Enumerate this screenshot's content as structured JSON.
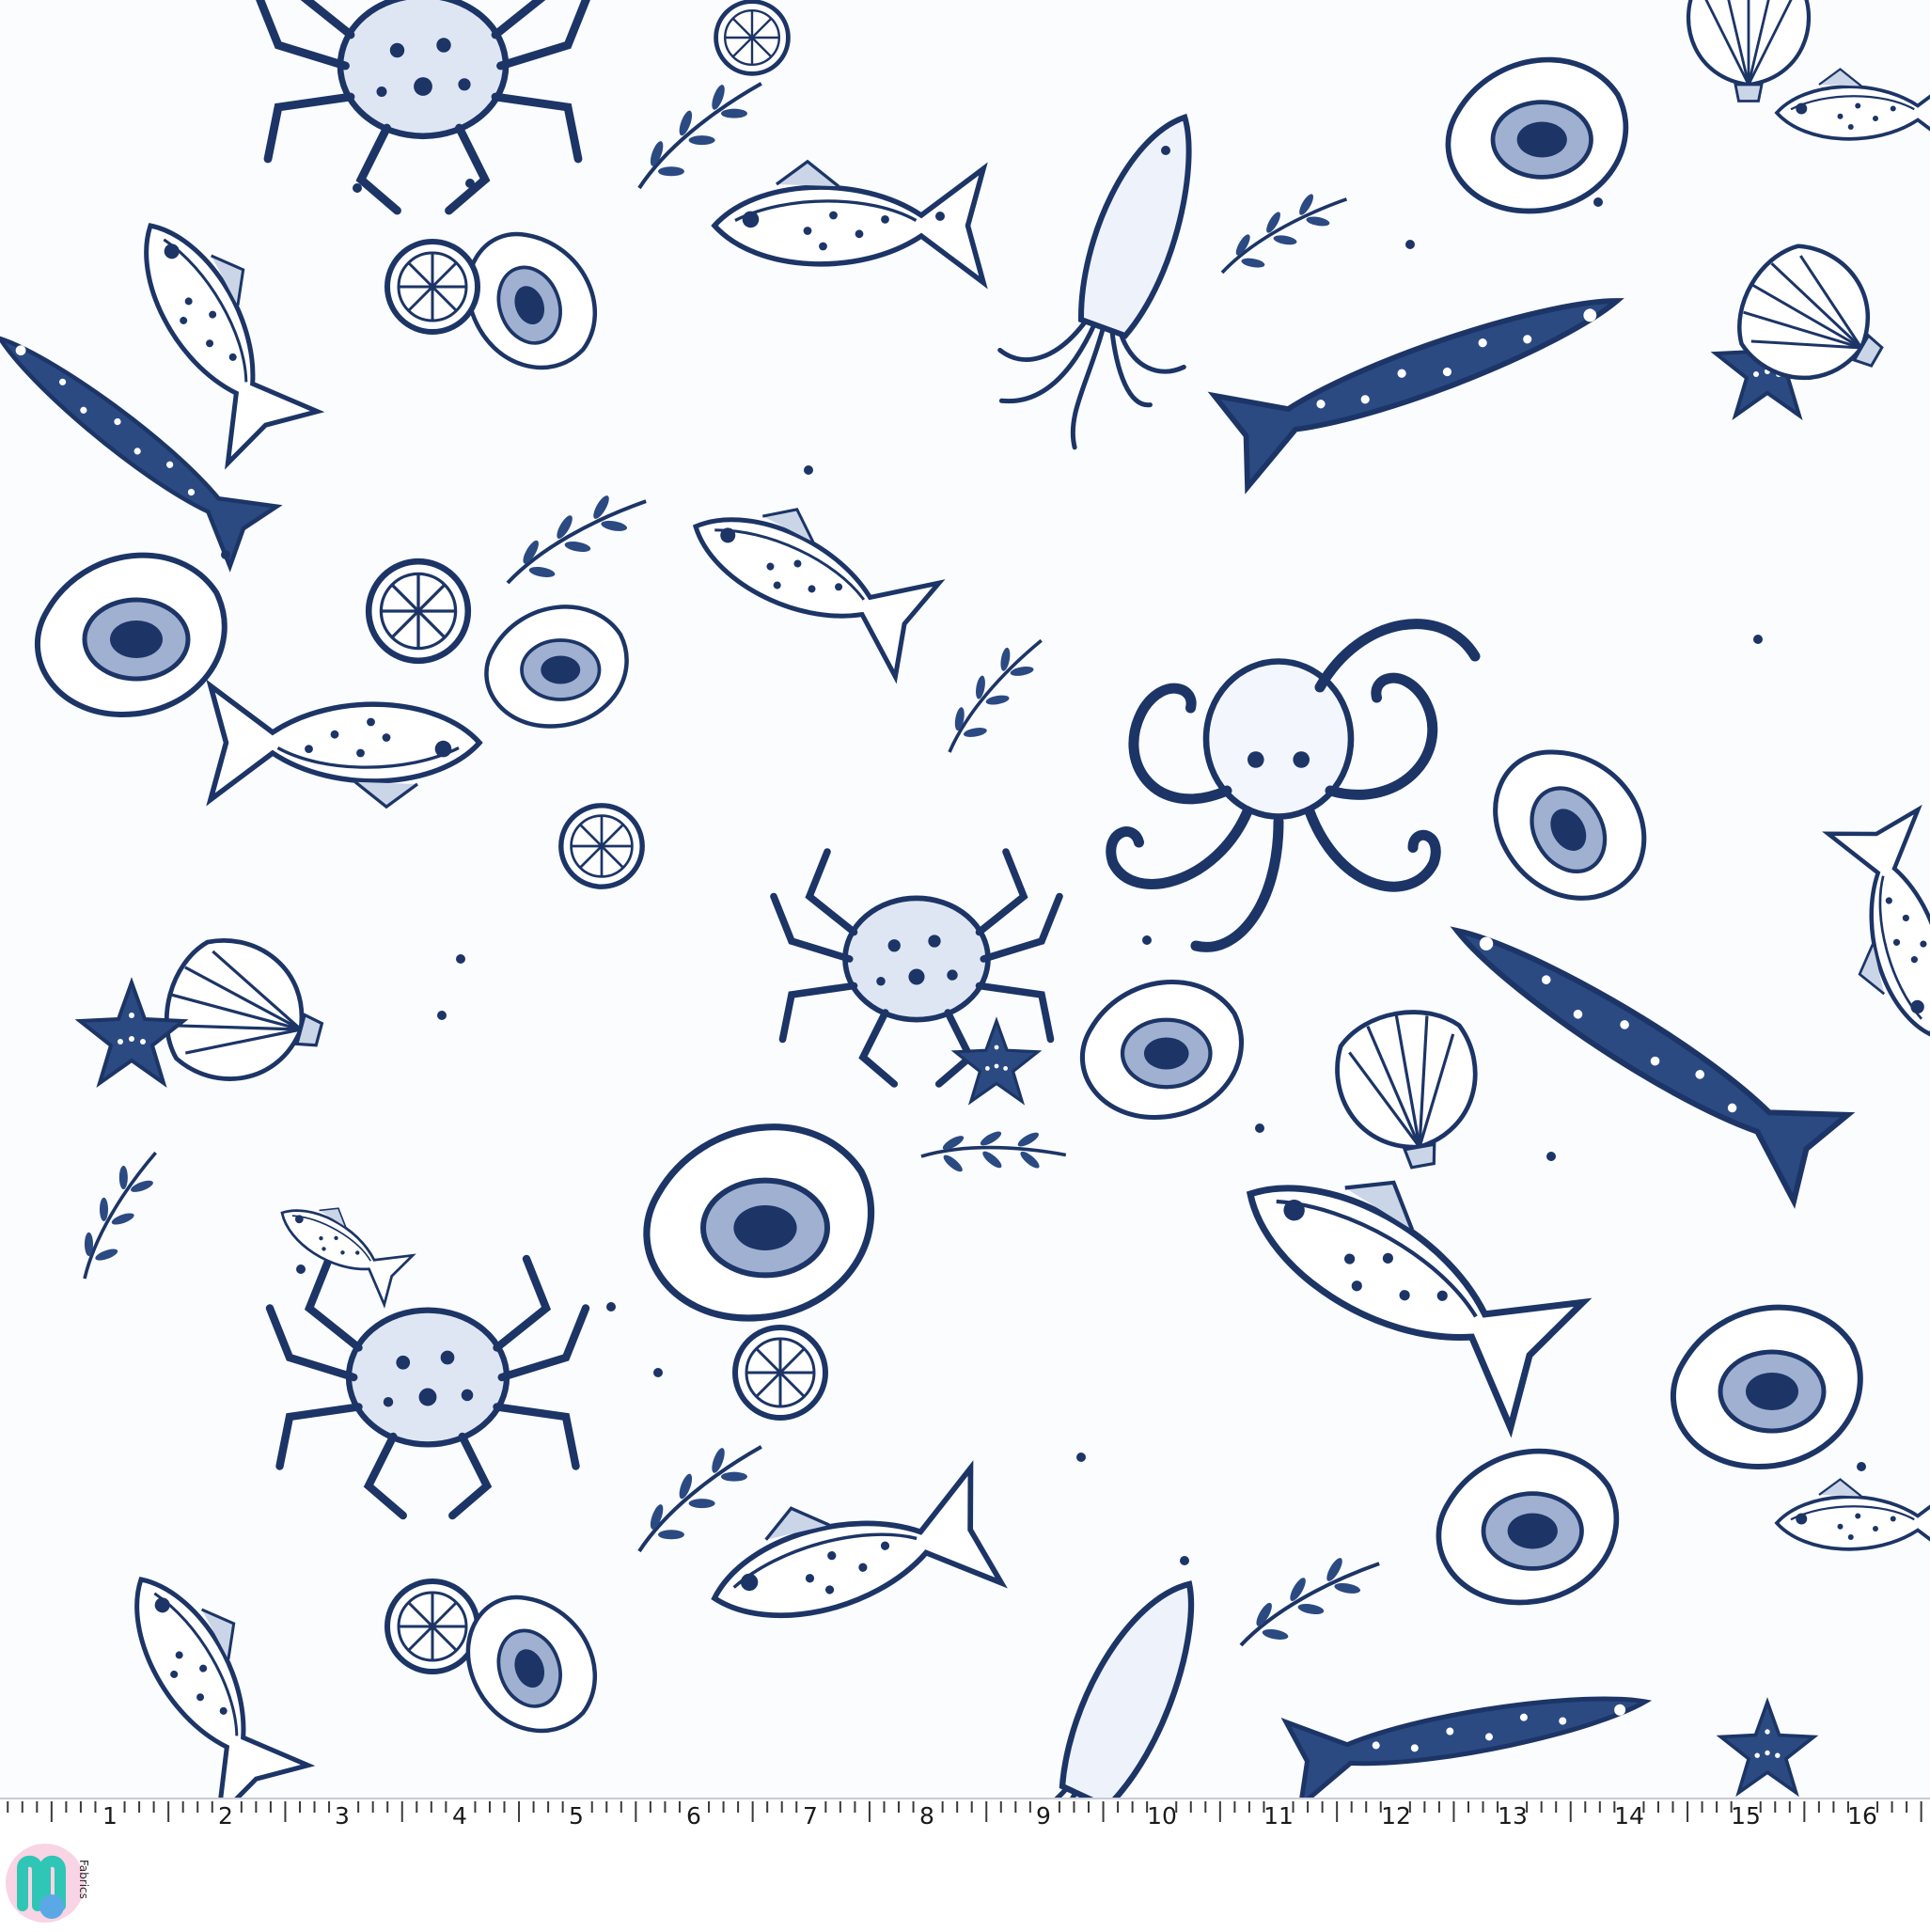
{
  "image": {
    "subject": "Blue and white seafood toile fabric print",
    "ink_color": "#1c3566",
    "ground_color": "#fbfcfe"
  },
  "ruler": {
    "unit_marks": [
      "1",
      "2",
      "3",
      "4",
      "5",
      "6",
      "7",
      "8",
      "9",
      "10",
      "11",
      "12",
      "13",
      "14",
      "15",
      "16"
    ]
  },
  "brand": {
    "text": "Fabrics",
    "logo_colors": [
      "#2fc6b6",
      "#f4a6c8",
      "#5aa9e6"
    ]
  }
}
